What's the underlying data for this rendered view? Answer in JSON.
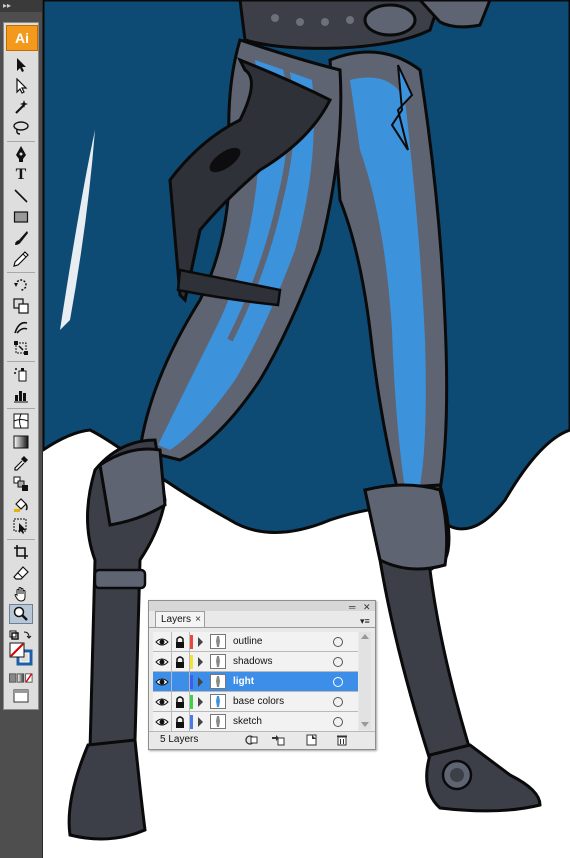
{
  "app": {
    "name": "Adobe Illustrator",
    "logo_text": "Ai",
    "grip_icon": "double-chevron-icon",
    "grip_glyph": "▸▸"
  },
  "colors": {
    "toolbar_bg": "#4e4e4e",
    "canvas_bg": "#ffffff",
    "cape": "#0d4a74",
    "suit_gray": "#5e6472",
    "stripe_blue": "#3d92dc",
    "selection_blue": "#3d8ee8"
  },
  "tools": [
    {
      "name": "selection-tool-icon"
    },
    {
      "name": "direct-selection-tool-icon"
    },
    {
      "name": "magic-wand-tool-icon"
    },
    {
      "name": "lasso-tool-icon"
    },
    {
      "name": "pen-tool-icon"
    },
    {
      "name": "type-tool-icon",
      "glyph": "T"
    },
    {
      "name": "line-segment-tool-icon"
    },
    {
      "name": "rectangle-tool-icon"
    },
    {
      "name": "paintbrush-tool-icon"
    },
    {
      "name": "pencil-tool-icon"
    },
    {
      "name": "rotate-tool-icon"
    },
    {
      "name": "scale-tool-icon"
    },
    {
      "name": "warp-tool-icon"
    },
    {
      "name": "free-transform-tool-icon"
    },
    {
      "name": "symbol-sprayer-tool-icon"
    },
    {
      "name": "column-graph-tool-icon"
    },
    {
      "name": "mesh-tool-icon"
    },
    {
      "name": "gradient-tool-icon"
    },
    {
      "name": "eyedropper-tool-icon"
    },
    {
      "name": "blend-tool-icon"
    },
    {
      "name": "live-paint-bucket-tool-icon"
    },
    {
      "name": "live-paint-selection-tool-icon"
    },
    {
      "name": "crop-area-tool-icon"
    },
    {
      "name": "eraser-tool-icon"
    },
    {
      "name": "hand-tool-icon"
    },
    {
      "name": "zoom-tool-icon",
      "selected": true
    },
    {
      "name": "default-fill-stroke-icon"
    },
    {
      "name": "fill-stroke-swatch-icon"
    },
    {
      "name": "color-gradient-none-icon"
    },
    {
      "name": "screen-mode-icon"
    }
  ],
  "layers_panel": {
    "tab_label": "Layers",
    "tab_close_glyph": "×",
    "minimize_glyph": "═",
    "close_glyph": "✕",
    "menu_glyph": "▾≡",
    "rows": [
      {
        "name": "outline",
        "color": "#e8453c",
        "visible": true,
        "locked": true,
        "active": false
      },
      {
        "name": "shadows",
        "color": "#f2e232",
        "visible": true,
        "locked": true,
        "active": false
      },
      {
        "name": "light",
        "color": "#3d5cf0",
        "visible": true,
        "locked": false,
        "active": true
      },
      {
        "name": "base colors",
        "color": "#3fd04a",
        "visible": true,
        "locked": true,
        "active": false
      },
      {
        "name": "sketch",
        "color": "#4a78e8",
        "visible": true,
        "locked": true,
        "active": false
      }
    ],
    "count_label": "5 Layers",
    "footer_buttons": [
      {
        "name": "make-clipping-mask-icon"
      },
      {
        "name": "create-new-sublayer-icon"
      },
      {
        "name": "create-new-layer-icon"
      },
      {
        "name": "delete-layer-icon"
      }
    ]
  }
}
